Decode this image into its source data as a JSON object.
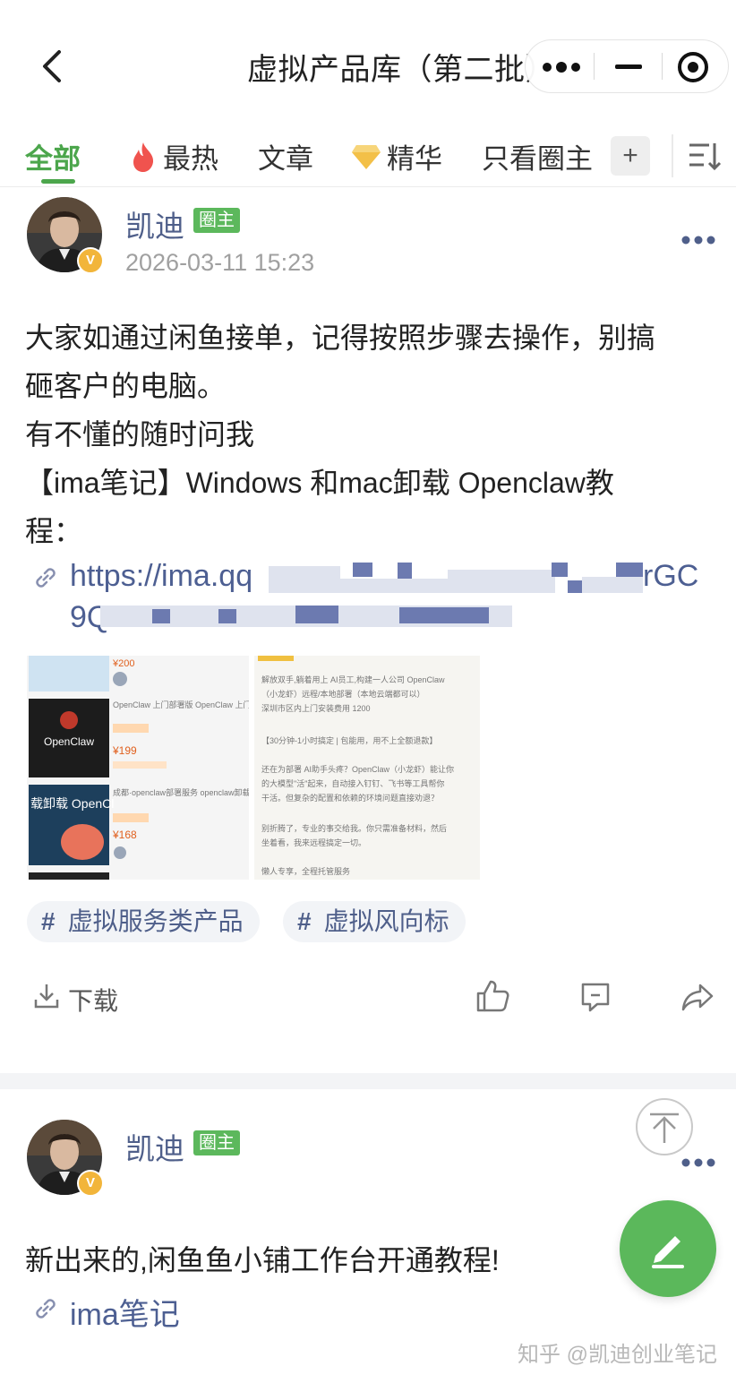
{
  "nav": {
    "title": "虚拟产品库（第二批）",
    "back_icon": "chevron-left-icon",
    "capsule": [
      "more-dots-icon",
      "minimize-icon",
      "close-target-icon"
    ]
  },
  "tabs": {
    "items": [
      "全部",
      "最热",
      "文章",
      "精华",
      "只看圈主"
    ],
    "active": "全部",
    "add_label": "+",
    "accent": "#4ca64c"
  },
  "post1": {
    "author": "凯迪",
    "role": "圈主",
    "time": "2026-03-11 15:23",
    "lines": [
      "大家如通过闲鱼接单，记得按照步骤去操作，别搞",
      "砸客户的电脑。",
      "有不懂的随时问我",
      "【ima笔记】Windows 和mac卸载 Openclaw教",
      "程："
    ],
    "link_line1": "https://ima.qq",
    "link_line1_tail": "rGC",
    "link_line2": "9Q",
    "images": {
      "left": {
        "price_top": "¥200",
        "item1_title": "OpenClaw 上门部署版 OpenClaw 上门部署版",
        "item1_brand": "OpenClaw",
        "item1_price": "¥199",
        "item2_title": "成都·openclaw部署服务 openclaw卸载服务，安全高效",
        "item2_banner": "载卸载 OpenCl",
        "item2_price": "¥168"
      },
      "right": {
        "lines": [
          "解放双手,躺着用上 AI员工,构建一人公司 OpenClaw",
          "（小龙虾）远程/本地部署（本地云端都可以）",
          "深圳市区内上门安装费用 1200",
          "【30分钟-1小时搞定 | 包能用，用不上全额退款】",
          "还在为部署 AI助手头疼？OpenClaw（小龙虾）能让你",
          "的大模型\"活\"起来，自动接入钉钉、飞书等工具帮你",
          "干活。但复杂的配置和依赖的环境问题直接劝退？",
          "别折腾了，专业的事交给我。你只需准备材料，然后",
          "坐着看，我来远程搞定一切。",
          "懒人专享，全程托管服务"
        ]
      }
    },
    "tags": [
      "虚拟服务类产品",
      "虚拟风向标"
    ],
    "download_label": "下载",
    "actions": [
      "like-icon",
      "comment-icon",
      "share-icon"
    ]
  },
  "post2": {
    "author": "凯迪",
    "role": "圈主",
    "text": "新出来的,闲鱼鱼小铺工作台开通教程!",
    "link": "ima笔记"
  },
  "watermark": "知乎 @凯迪创业笔记",
  "colors": {
    "author": "#4f5f8a",
    "link": "#4d5f92",
    "green": "#5bb85b",
    "badge": "#f2b53a"
  }
}
